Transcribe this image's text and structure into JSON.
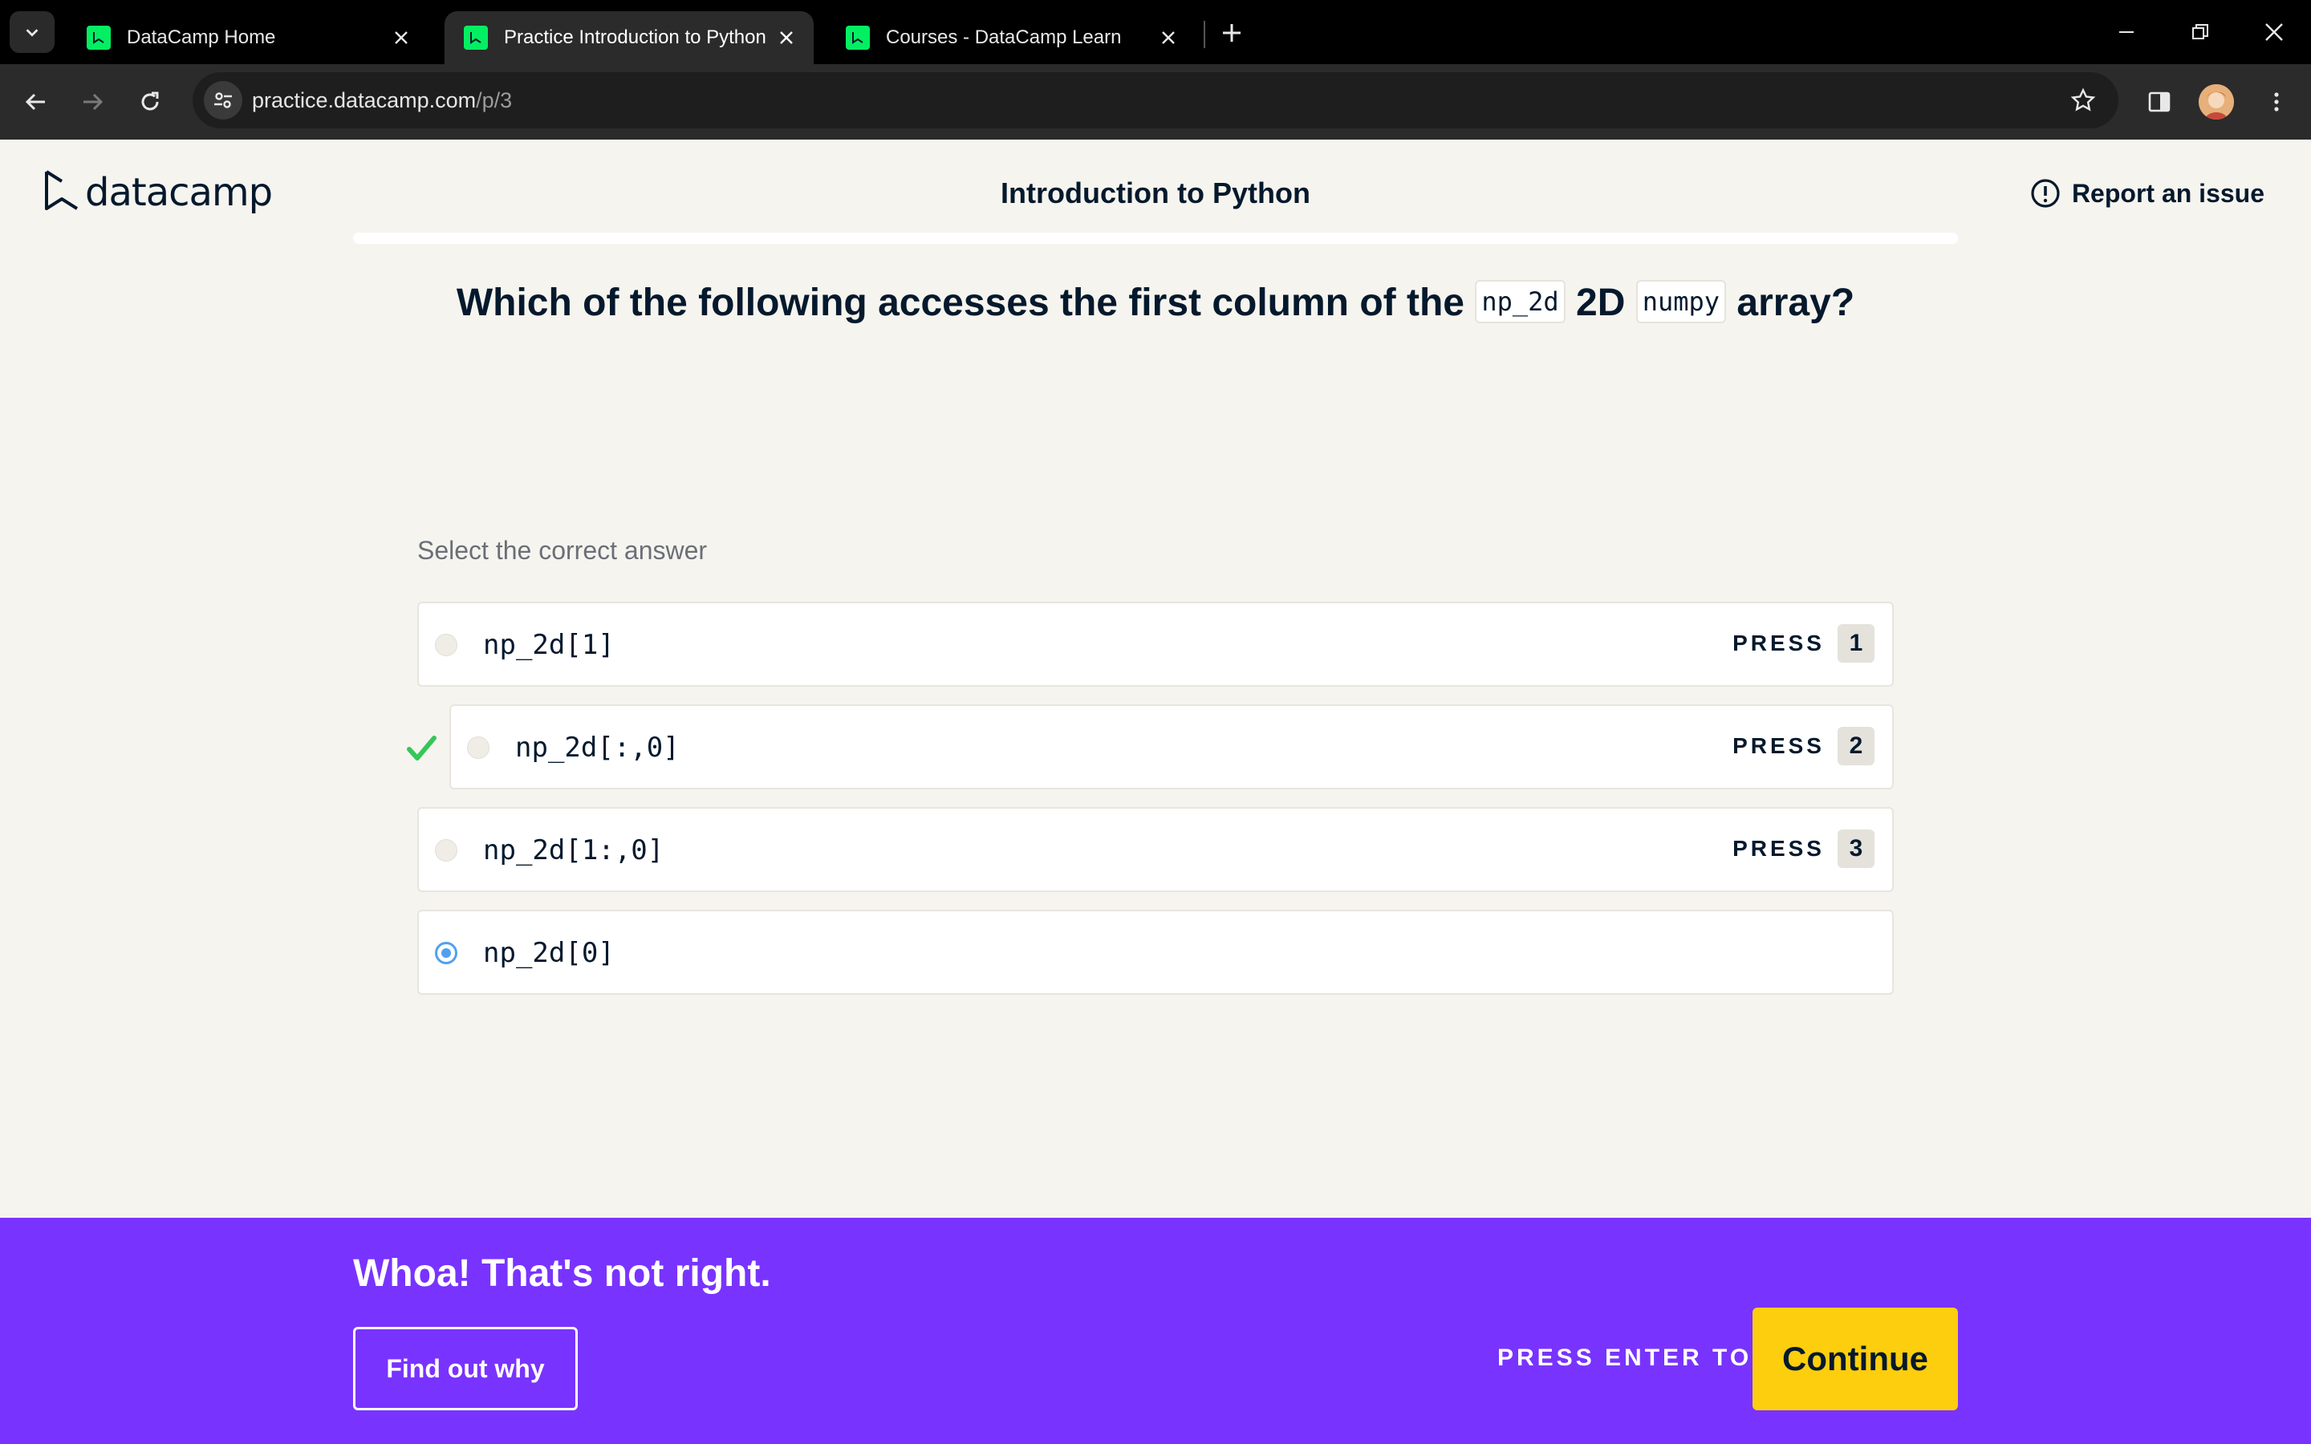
{
  "browser": {
    "tabs": [
      {
        "title": "DataCamp Home",
        "active": false
      },
      {
        "title": "Practice Introduction to Python",
        "active": true
      },
      {
        "title": "Courses - DataCamp Learn",
        "active": false
      }
    ],
    "url_host": "practice.datacamp.com",
    "url_path": "/p/3"
  },
  "header": {
    "logo_text": "datacamp",
    "course_title": "Introduction to Python",
    "report_label": "Report an issue"
  },
  "question": {
    "part1": "Which of the following accesses the first column of the",
    "code1": "np_2d",
    "part2": "2D",
    "code2": "numpy",
    "part3": "array?"
  },
  "instruction": "Select the correct answer",
  "options": [
    {
      "label": "np_2d[1]",
      "press_word": "PRESS",
      "key": "1",
      "selected": false,
      "correct": false
    },
    {
      "label": "np_2d[:,0]",
      "press_word": "PRESS",
      "key": "2",
      "selected": false,
      "correct": true
    },
    {
      "label": "np_2d[1:,0]",
      "press_word": "PRESS",
      "key": "3",
      "selected": false,
      "correct": false
    },
    {
      "label": "np_2d[0]",
      "selected": true,
      "correct": false
    }
  ],
  "feedback": {
    "message": "Whoa! That's not right.",
    "find_out_label": "Find out why",
    "press_enter_label": "PRESS ENTER TO",
    "continue_label": "Continue"
  },
  "colors": {
    "banner": "#7933ff",
    "continue": "#fcce0d",
    "correct_check": "#34c759",
    "selected_radio": "#4fa1ef",
    "brand_green": "#03ef62"
  }
}
